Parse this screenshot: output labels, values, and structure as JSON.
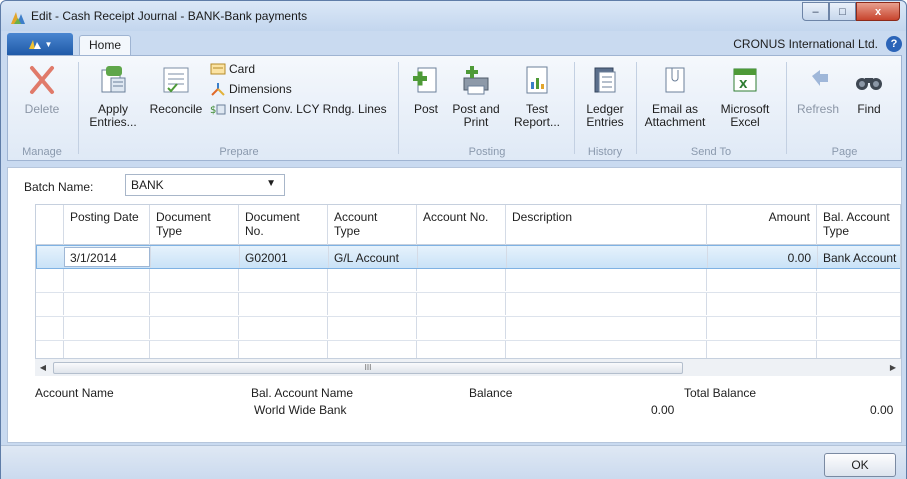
{
  "window": {
    "title": "Edit - Cash Receipt Journal - BANK-Bank payments",
    "minimize_glyph": "–",
    "maximize_glyph": "□",
    "close_glyph": "x"
  },
  "ribbon_tabs": {
    "home": "Home",
    "company": "CRONUS International Ltd.",
    "help_glyph": "?"
  },
  "ribbon": {
    "manage": {
      "label": "Manage",
      "delete": "Delete"
    },
    "prepare": {
      "label": "Prepare",
      "apply_entries_line1": "Apply",
      "apply_entries_line2": "Entries...",
      "reconcile": "Reconcile",
      "card": "Card",
      "dimensions": "Dimensions",
      "insert_conv": "Insert Conv. LCY Rndg. Lines"
    },
    "posting": {
      "label": "Posting",
      "post": "Post",
      "post_and_print_line1": "Post and",
      "post_and_print_line2": "Print",
      "test_report_line1": "Test",
      "test_report_line2": "Report..."
    },
    "history": {
      "label": "History",
      "ledger_entries_line1": "Ledger",
      "ledger_entries_line2": "Entries"
    },
    "send_to": {
      "label": "Send To",
      "email_line1": "Email as",
      "email_line2": "Attachment",
      "excel_line1": "Microsoft",
      "excel_line2": "Excel"
    },
    "page": {
      "label": "Page",
      "refresh": "Refresh",
      "find": "Find"
    }
  },
  "batch": {
    "label": "Batch Name:",
    "value": "BANK",
    "arrow": "▼"
  },
  "grid": {
    "columns": [
      {
        "line1": "Posting Date",
        "line2": ""
      },
      {
        "line1": "Document",
        "line2": "Type"
      },
      {
        "line1": "Document",
        "line2": "No."
      },
      {
        "line1": "Account",
        "line2": "Type"
      },
      {
        "line1": "Account No.",
        "line2": ""
      },
      {
        "line1": "Description",
        "line2": ""
      },
      {
        "line1": "Amount",
        "line2": ""
      },
      {
        "line1": "Bal. Account",
        "line2": "Type"
      }
    ],
    "rows": [
      {
        "posting_date": "3/1/2014",
        "document_type": "",
        "document_no": "G02001",
        "account_type": "G/L Account",
        "account_no": "",
        "description": "",
        "amount": "0.00",
        "bal_account_type": "Bank Account"
      }
    ],
    "scroll_thumb_glyph": "III",
    "scroll_left": "◀",
    "scroll_right": "▶"
  },
  "footer_fields": {
    "account_name_label": "Account Name",
    "bal_account_name_label": "Bal. Account Name",
    "bal_account_name_value": "World Wide Bank",
    "balance_label": "Balance",
    "balance_value": "0.00",
    "total_balance_label": "Total Balance",
    "total_balance_value": "0.00"
  },
  "buttons": {
    "ok": "OK"
  },
  "colors": {
    "title_bar": "#c3d6ee",
    "ribbon_app_button": "#1f5aa7",
    "selected_row": "#c9e2f7",
    "close_button": "#c7442d"
  }
}
